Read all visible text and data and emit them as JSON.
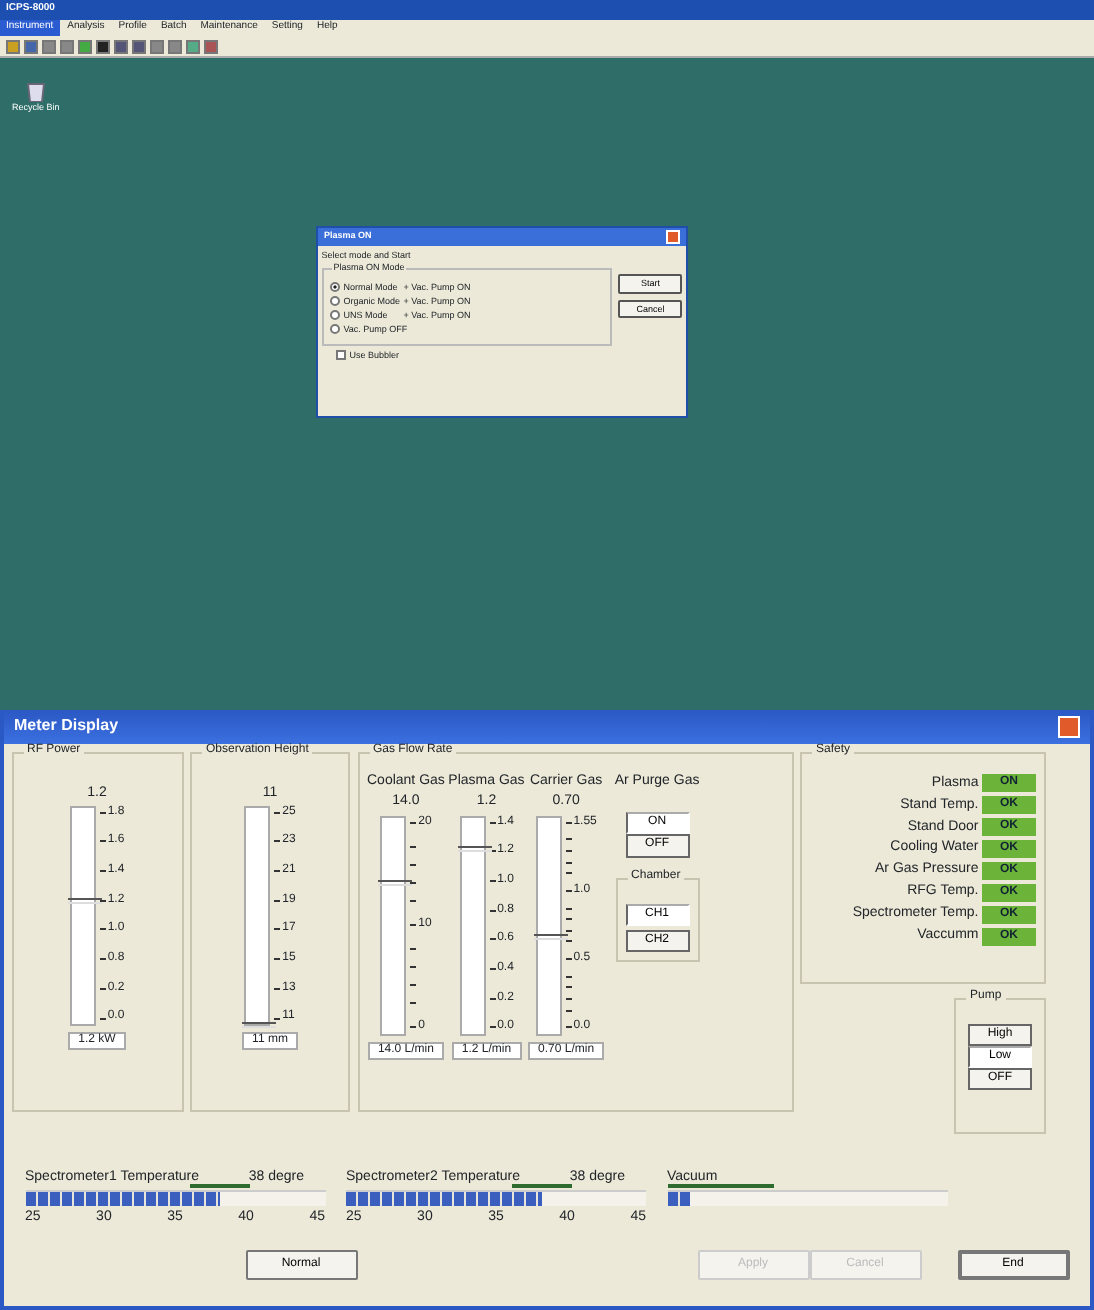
{
  "app": {
    "title": "ICPS-8000",
    "menu": [
      {
        "label": "Instrument",
        "selected": true
      },
      {
        "label": "Analysis",
        "selected": false
      },
      {
        "label": "Profile",
        "selected": false
      },
      {
        "label": "Batch",
        "selected": false
      },
      {
        "label": "Maintenance",
        "selected": false
      },
      {
        "label": "Setting",
        "selected": false
      },
      {
        "label": "Help",
        "selected": false
      }
    ],
    "desktop_icon": "Recycle Bin"
  },
  "dialog": {
    "title": "Plasma ON",
    "prompt": "Select mode and Start",
    "group_label": "Plasma ON Mode",
    "modes": [
      {
        "label": "Normal Mode",
        "note": "+ Vac. Pump ON",
        "selected": true
      },
      {
        "label": "Organic Mode",
        "note": "+ Vac. Pump ON",
        "selected": false
      },
      {
        "label": "UNS Mode",
        "note": "+ Vac. Pump ON",
        "selected": false
      },
      {
        "label": "Vac. Pump OFF",
        "selected": false
      }
    ],
    "buttons": [
      "Start",
      "Cancel"
    ],
    "bubbler": {
      "label": "Use Bubbler",
      "checked": false
    }
  },
  "meter": {
    "title": "Meter Display",
    "rf_power": {
      "label": "RF Power",
      "reading": "1.2",
      "ticks": [
        "1.8",
        "1.6",
        "1.4",
        "1.2",
        "1.0",
        "0.8",
        "0.2",
        "0.0"
      ],
      "level": 0.57,
      "value": "1.2 kW"
    },
    "observation_height": {
      "label": "Observation Height",
      "reading": "11",
      "ticks": [
        "25",
        "23",
        "21",
        "19",
        "17",
        "15",
        "13",
        "11"
      ],
      "level": 0,
      "value": "11 mm"
    },
    "gas_flow": {
      "label": "Gas Flow Rate",
      "gases": [
        {
          "label": "Coolant Gas",
          "reading": "14.0",
          "ticks": [
            "20",
            "10",
            "0"
          ],
          "level": 0.7,
          "value": "14.0 L/min"
        },
        {
          "label": "Plasma Gas",
          "reading": "1.2",
          "ticks": [
            "1.4",
            "1.2",
            "1.0",
            "0.8",
            "0.6",
            "0.4",
            "0.2",
            "0.0"
          ],
          "level": 0.86,
          "value": "1.2 L/min"
        },
        {
          "label": "Carrier Gas",
          "reading": "0.70",
          "ticks": [
            "1.55",
            "1.0",
            "0.5",
            "0.0"
          ],
          "level": 0.45,
          "value": "0.70 L/min"
        }
      ],
      "purge": {
        "label": "Ar Purge Gas",
        "buttons": [
          {
            "label": "ON",
            "selected": true
          },
          {
            "label": "OFF",
            "selected": false
          }
        ]
      },
      "chamber": {
        "label": "Chamber",
        "buttons": [
          {
            "label": "CH1",
            "selected": true
          },
          {
            "label": "CH2",
            "selected": false
          }
        ]
      }
    },
    "safety": {
      "label": "Safety",
      "items": [
        {
          "label": "Plasma",
          "status": "ON"
        },
        {
          "label": "Stand Temp.",
          "status": "OK"
        },
        {
          "label": "Stand Door",
          "status": "OK"
        },
        {
          "label": "Cooling Water",
          "status": "OK"
        },
        {
          "label": "Ar Gas Pressure",
          "status": "OK"
        },
        {
          "label": "RFG Temp.",
          "status": "OK"
        },
        {
          "label": "Spectrometer Temp.",
          "status": "OK"
        },
        {
          "label": "Vaccumm",
          "status": "OK"
        }
      ]
    },
    "pump": {
      "label": "Pump",
      "buttons": [
        {
          "label": "High",
          "selected": false
        },
        {
          "label": "Low",
          "selected": true
        },
        {
          "label": "OFF",
          "selected": false
        }
      ]
    },
    "gauges": [
      {
        "label": "Spectrometer1 Temperature",
        "reading": "38 degre",
        "level": 0.65,
        "scale": [
          "25",
          "30",
          "35",
          "40",
          "45"
        ]
      },
      {
        "label": "Spectrometer2 Temperature",
        "reading": "38 degre",
        "level": 0.65,
        "scale": [
          "25",
          "30",
          "35",
          "40",
          "45"
        ]
      },
      {
        "label": "Vacuum",
        "level": 0.08
      }
    ],
    "buttons": [
      {
        "label": "Normal",
        "disabled": false
      },
      {
        "label": "Apply",
        "disabled": true
      },
      {
        "label": "Cancel",
        "disabled": true
      },
      {
        "label": "End",
        "disabled": false
      }
    ]
  }
}
